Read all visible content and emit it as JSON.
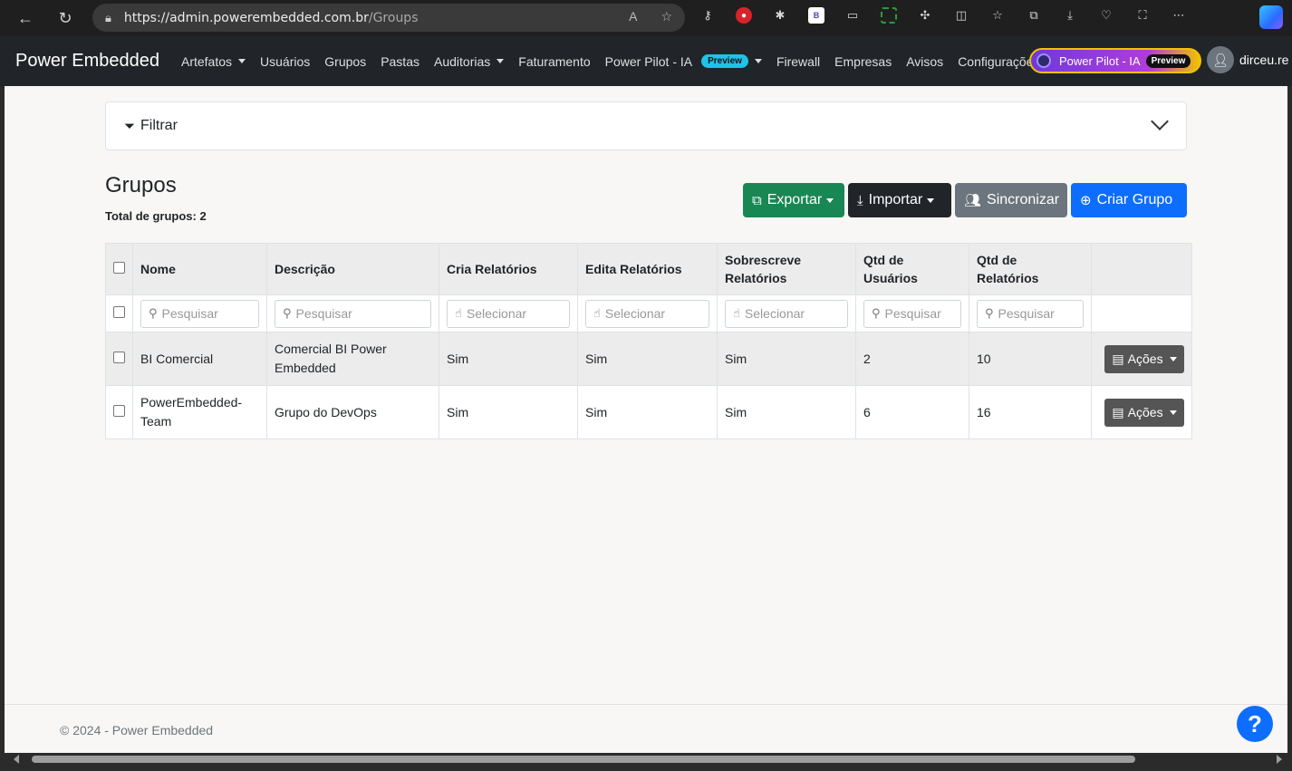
{
  "browser": {
    "url_host": "https://admin.powerembedded.com.br",
    "url_path": "/Groups",
    "back_icon": "←",
    "refresh_icon": "↻"
  },
  "navbar": {
    "brand": "Power Embedded",
    "items": {
      "artefatos": "Artefatos",
      "usuarios": "Usuários",
      "grupos": "Grupos",
      "pastas": "Pastas",
      "auditorias": "Auditorias",
      "faturamento": "Faturamento",
      "power_pilot": "Power Pilot - IA",
      "power_pilot_badge": "Preview",
      "firewall": "Firewall",
      "empresas": "Empresas",
      "avisos": "Avisos",
      "configuracoes": "Configurações"
    },
    "pilot_button": {
      "label": "Power Pilot - IA",
      "badge": "Preview"
    },
    "user": "dirceu.re"
  },
  "filter": {
    "label": "Filtrar"
  },
  "page": {
    "title": "Grupos",
    "total": "Total de grupos: 2"
  },
  "actions": {
    "export": "Exportar",
    "import": "Importar",
    "sync": "Sincronizar",
    "create": "Criar Grupo"
  },
  "table": {
    "headers": {
      "nome": "Nome",
      "descricao": "Descrição",
      "cria": "Cria Relatórios",
      "edita": "Edita Relatórios",
      "sobrescreve_1": "Sobrescreve",
      "sobrescreve_2": "Relatórios",
      "qtd_usuarios_1": "Qtd de",
      "qtd_usuarios_2": "Usuários",
      "qtd_relatorios_1": "Qtd de",
      "qtd_relatorios_2": "Relatórios"
    },
    "filters": {
      "search_placeholder": "Pesquisar",
      "select_placeholder": "Selecionar"
    },
    "rows": [
      {
        "nome": "BI Comercial",
        "descricao": "Comercial BI Power Embedded",
        "cria": "Sim",
        "edita": "Sim",
        "sobrescreve": "Sim",
        "qtd_usuarios": "2",
        "qtd_relatorios": "10",
        "acoes": "Ações"
      },
      {
        "nome": "PowerEmbedded-Team",
        "descricao": "Grupo do DevOps",
        "cria": "Sim",
        "edita": "Sim",
        "sobrescreve": "Sim",
        "qtd_usuarios": "6",
        "qtd_relatorios": "16",
        "acoes": "Ações"
      }
    ]
  },
  "footer": {
    "text": "© 2024 - Power Embedded",
    "help": "?"
  }
}
